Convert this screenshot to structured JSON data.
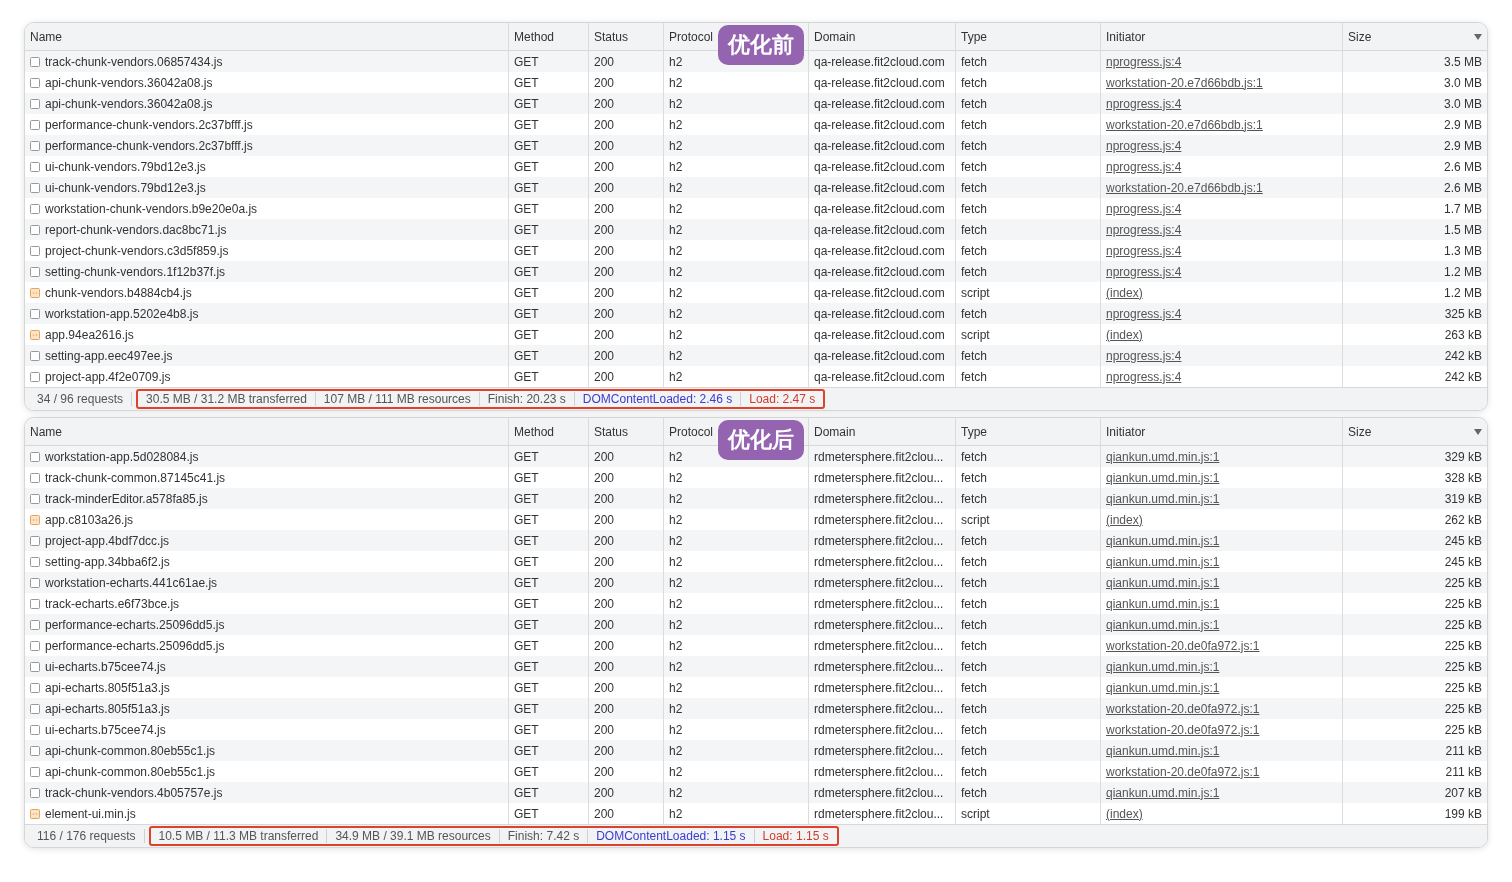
{
  "panels": [
    {
      "label": "优化前",
      "columns": [
        "Name",
        "Method",
        "Status",
        "Protocol",
        "Domain",
        "Type",
        "Initiator",
        "Size"
      ],
      "rows": [
        {
          "kind": "fetch",
          "name": "track-chunk-vendors.06857434.js",
          "method": "GET",
          "status": "200",
          "protocol": "h2",
          "domain": "qa-release.fit2cloud.com",
          "type": "fetch",
          "initiator": "nprogress.js:4",
          "size": "3.5 MB"
        },
        {
          "kind": "fetch",
          "name": "api-chunk-vendors.36042a08.js",
          "method": "GET",
          "status": "200",
          "protocol": "h2",
          "domain": "qa-release.fit2cloud.com",
          "type": "fetch",
          "initiator": "workstation-20.e7d66bdb.js:1",
          "size": "3.0 MB"
        },
        {
          "kind": "fetch",
          "name": "api-chunk-vendors.36042a08.js",
          "method": "GET",
          "status": "200",
          "protocol": "h2",
          "domain": "qa-release.fit2cloud.com",
          "type": "fetch",
          "initiator": "nprogress.js:4",
          "size": "3.0 MB"
        },
        {
          "kind": "fetch",
          "name": "performance-chunk-vendors.2c37bfff.js",
          "method": "GET",
          "status": "200",
          "protocol": "h2",
          "domain": "qa-release.fit2cloud.com",
          "type": "fetch",
          "initiator": "workstation-20.e7d66bdb.js:1",
          "size": "2.9 MB"
        },
        {
          "kind": "fetch",
          "name": "performance-chunk-vendors.2c37bfff.js",
          "method": "GET",
          "status": "200",
          "protocol": "h2",
          "domain": "qa-release.fit2cloud.com",
          "type": "fetch",
          "initiator": "nprogress.js:4",
          "size": "2.9 MB"
        },
        {
          "kind": "fetch",
          "name": "ui-chunk-vendors.79bd12e3.js",
          "method": "GET",
          "status": "200",
          "protocol": "h2",
          "domain": "qa-release.fit2cloud.com",
          "type": "fetch",
          "initiator": "nprogress.js:4",
          "size": "2.6 MB"
        },
        {
          "kind": "fetch",
          "name": "ui-chunk-vendors.79bd12e3.js",
          "method": "GET",
          "status": "200",
          "protocol": "h2",
          "domain": "qa-release.fit2cloud.com",
          "type": "fetch",
          "initiator": "workstation-20.e7d66bdb.js:1",
          "size": "2.6 MB"
        },
        {
          "kind": "fetch",
          "name": "workstation-chunk-vendors.b9e20e0a.js",
          "method": "GET",
          "status": "200",
          "protocol": "h2",
          "domain": "qa-release.fit2cloud.com",
          "type": "fetch",
          "initiator": "nprogress.js:4",
          "size": "1.7 MB"
        },
        {
          "kind": "fetch",
          "name": "report-chunk-vendors.dac8bc71.js",
          "method": "GET",
          "status": "200",
          "protocol": "h2",
          "domain": "qa-release.fit2cloud.com",
          "type": "fetch",
          "initiator": "nprogress.js:4",
          "size": "1.5 MB"
        },
        {
          "kind": "fetch",
          "name": "project-chunk-vendors.c3d5f859.js",
          "method": "GET",
          "status": "200",
          "protocol": "h2",
          "domain": "qa-release.fit2cloud.com",
          "type": "fetch",
          "initiator": "nprogress.js:4",
          "size": "1.3 MB"
        },
        {
          "kind": "fetch",
          "name": "setting-chunk-vendors.1f12b37f.js",
          "method": "GET",
          "status": "200",
          "protocol": "h2",
          "domain": "qa-release.fit2cloud.com",
          "type": "fetch",
          "initiator": "nprogress.js:4",
          "size": "1.2 MB"
        },
        {
          "kind": "script",
          "name": "chunk-vendors.b4884cb4.js",
          "method": "GET",
          "status": "200",
          "protocol": "h2",
          "domain": "qa-release.fit2cloud.com",
          "type": "script",
          "initiator": "(index)",
          "size": "1.2 MB"
        },
        {
          "kind": "fetch",
          "name": "workstation-app.5202e4b8.js",
          "method": "GET",
          "status": "200",
          "protocol": "h2",
          "domain": "qa-release.fit2cloud.com",
          "type": "fetch",
          "initiator": "nprogress.js:4",
          "size": "325 kB"
        },
        {
          "kind": "script",
          "name": "app.94ea2616.js",
          "method": "GET",
          "status": "200",
          "protocol": "h2",
          "domain": "qa-release.fit2cloud.com",
          "type": "script",
          "initiator": "(index)",
          "size": "263 kB"
        },
        {
          "kind": "fetch",
          "name": "setting-app.eec497ee.js",
          "method": "GET",
          "status": "200",
          "protocol": "h2",
          "domain": "qa-release.fit2cloud.com",
          "type": "fetch",
          "initiator": "nprogress.js:4",
          "size": "242 kB"
        },
        {
          "kind": "fetch",
          "name": "project-app.4f2e0709.js",
          "method": "GET",
          "status": "200",
          "protocol": "h2",
          "domain": "qa-release.fit2cloud.com",
          "type": "fetch",
          "initiator": "nprogress.js:4",
          "size": "242 kB"
        }
      ],
      "status_bar": {
        "requests": "34 / 96 requests",
        "transferred": "30.5 MB / 31.2 MB transferred",
        "resources": "107 MB / 111 MB resources",
        "finish": "Finish: 20.23 s",
        "dom_content_loaded": "DOMContentLoaded: 2.46 s",
        "load": "Load: 2.47 s"
      }
    },
    {
      "label": "优化后",
      "columns": [
        "Name",
        "Method",
        "Status",
        "Protocol",
        "Domain",
        "Type",
        "Initiator",
        "Size"
      ],
      "rows": [
        {
          "kind": "fetch",
          "name": "workstation-app.5d028084.js",
          "method": "GET",
          "status": "200",
          "protocol": "h2",
          "domain": "rdmetersphere.fit2clou...",
          "type": "fetch",
          "initiator": "qiankun.umd.min.js:1",
          "size": "329 kB"
        },
        {
          "kind": "fetch",
          "name": "track-chunk-common.87145c41.js",
          "method": "GET",
          "status": "200",
          "protocol": "h2",
          "domain": "rdmetersphere.fit2clou...",
          "type": "fetch",
          "initiator": "qiankun.umd.min.js:1",
          "size": "328 kB"
        },
        {
          "kind": "fetch",
          "name": "track-minderEditor.a578fa85.js",
          "method": "GET",
          "status": "200",
          "protocol": "h2",
          "domain": "rdmetersphere.fit2clou...",
          "type": "fetch",
          "initiator": "qiankun.umd.min.js:1",
          "size": "319 kB"
        },
        {
          "kind": "script",
          "name": "app.c8103a26.js",
          "method": "GET",
          "status": "200",
          "protocol": "h2",
          "domain": "rdmetersphere.fit2clou...",
          "type": "script",
          "initiator": "(index)",
          "size": "262 kB"
        },
        {
          "kind": "fetch",
          "name": "project-app.4bdf7dcc.js",
          "method": "GET",
          "status": "200",
          "protocol": "h2",
          "domain": "rdmetersphere.fit2clou...",
          "type": "fetch",
          "initiator": "qiankun.umd.min.js:1",
          "size": "245 kB"
        },
        {
          "kind": "fetch",
          "name": "setting-app.34bba6f2.js",
          "method": "GET",
          "status": "200",
          "protocol": "h2",
          "domain": "rdmetersphere.fit2clou...",
          "type": "fetch",
          "initiator": "qiankun.umd.min.js:1",
          "size": "245 kB"
        },
        {
          "kind": "fetch",
          "name": "workstation-echarts.441c61ae.js",
          "method": "GET",
          "status": "200",
          "protocol": "h2",
          "domain": "rdmetersphere.fit2clou...",
          "type": "fetch",
          "initiator": "qiankun.umd.min.js:1",
          "size": "225 kB"
        },
        {
          "kind": "fetch",
          "name": "track-echarts.e6f73bce.js",
          "method": "GET",
          "status": "200",
          "protocol": "h2",
          "domain": "rdmetersphere.fit2clou...",
          "type": "fetch",
          "initiator": "qiankun.umd.min.js:1",
          "size": "225 kB"
        },
        {
          "kind": "fetch",
          "name": "performance-echarts.25096dd5.js",
          "method": "GET",
          "status": "200",
          "protocol": "h2",
          "domain": "rdmetersphere.fit2clou...",
          "type": "fetch",
          "initiator": "qiankun.umd.min.js:1",
          "size": "225 kB"
        },
        {
          "kind": "fetch",
          "name": "performance-echarts.25096dd5.js",
          "method": "GET",
          "status": "200",
          "protocol": "h2",
          "domain": "rdmetersphere.fit2clou...",
          "type": "fetch",
          "initiator": "workstation-20.de0fa972.js:1",
          "size": "225 kB"
        },
        {
          "kind": "fetch",
          "name": "ui-echarts.b75cee74.js",
          "method": "GET",
          "status": "200",
          "protocol": "h2",
          "domain": "rdmetersphere.fit2clou...",
          "type": "fetch",
          "initiator": "qiankun.umd.min.js:1",
          "size": "225 kB"
        },
        {
          "kind": "fetch",
          "name": "api-echarts.805f51a3.js",
          "method": "GET",
          "status": "200",
          "protocol": "h2",
          "domain": "rdmetersphere.fit2clou...",
          "type": "fetch",
          "initiator": "qiankun.umd.min.js:1",
          "size": "225 kB"
        },
        {
          "kind": "fetch",
          "name": "api-echarts.805f51a3.js",
          "method": "GET",
          "status": "200",
          "protocol": "h2",
          "domain": "rdmetersphere.fit2clou...",
          "type": "fetch",
          "initiator": "workstation-20.de0fa972.js:1",
          "size": "225 kB"
        },
        {
          "kind": "fetch",
          "name": "ui-echarts.b75cee74.js",
          "method": "GET",
          "status": "200",
          "protocol": "h2",
          "domain": "rdmetersphere.fit2clou...",
          "type": "fetch",
          "initiator": "workstation-20.de0fa972.js:1",
          "size": "225 kB"
        },
        {
          "kind": "fetch",
          "name": "api-chunk-common.80eb55c1.js",
          "method": "GET",
          "status": "200",
          "protocol": "h2",
          "domain": "rdmetersphere.fit2clou...",
          "type": "fetch",
          "initiator": "qiankun.umd.min.js:1",
          "size": "211 kB"
        },
        {
          "kind": "fetch",
          "name": "api-chunk-common.80eb55c1.js",
          "method": "GET",
          "status": "200",
          "protocol": "h2",
          "domain": "rdmetersphere.fit2clou...",
          "type": "fetch",
          "initiator": "workstation-20.de0fa972.js:1",
          "size": "211 kB"
        },
        {
          "kind": "fetch",
          "name": "track-chunk-vendors.4b05757e.js",
          "method": "GET",
          "status": "200",
          "protocol": "h2",
          "domain": "rdmetersphere.fit2clou...",
          "type": "fetch",
          "initiator": "qiankun.umd.min.js:1",
          "size": "207 kB"
        },
        {
          "kind": "script",
          "name": "element-ui.min.js",
          "method": "GET",
          "status": "200",
          "protocol": "h2",
          "domain": "rdmetersphere.fit2clou...",
          "type": "script",
          "initiator": "(index)",
          "size": "199 kB"
        }
      ],
      "status_bar": {
        "requests": "116 / 176 requests",
        "transferred": "10.5 MB / 11.3 MB transferred",
        "resources": "34.9 MB / 39.1 MB resources",
        "finish": "Finish: 7.42 s",
        "dom_content_loaded": "DOMContentLoaded: 1.15 s",
        "load": "Load: 1.15 s"
      }
    }
  ]
}
